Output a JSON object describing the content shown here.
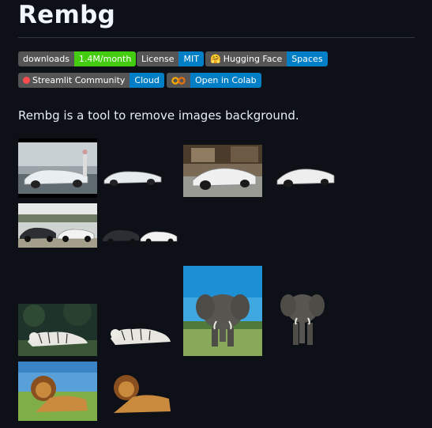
{
  "title": "Rembg",
  "badges": [
    {
      "left": "downloads",
      "right": "1.4M/month",
      "color": "#4c1"
    },
    {
      "left": "License",
      "right": "MIT",
      "color": "#007ec6"
    },
    {
      "left": "Hugging Face",
      "right": "Spaces",
      "color": "#007ec6",
      "icon": "hugging-face-icon"
    },
    {
      "left": "Streamlit Community",
      "right": "Cloud",
      "color": "#007ec6",
      "icon": "streamlit-icon"
    },
    {
      "left": "",
      "right": "Open in Colab",
      "color": "#007ec6",
      "icon": "colab-icon"
    }
  ],
  "description": "Rembg is a tool to remove images background."
}
